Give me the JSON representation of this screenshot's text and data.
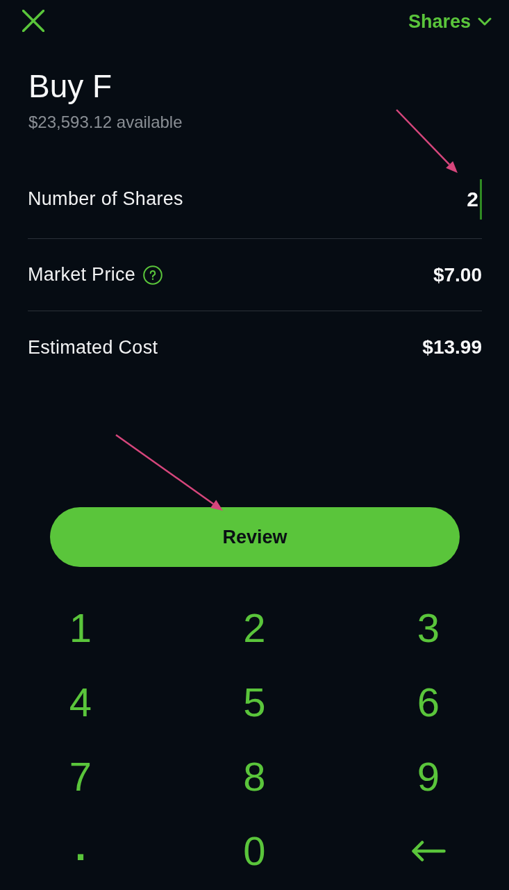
{
  "header": {
    "order_type": {
      "label": "Shares",
      "expanded": false
    }
  },
  "title": "Buy F",
  "buying_power": "$23,593.12 available",
  "rows": [
    {
      "kind": "input",
      "label": "Number of Shares",
      "value": "2",
      "focused": true,
      "help": false
    },
    {
      "kind": "static",
      "label": "Market Price",
      "value": "$7.00",
      "help": true
    },
    {
      "kind": "static",
      "label": "Estimated Cost",
      "value": "$13.99",
      "help": false
    }
  ],
  "review_button": {
    "label": "Review"
  },
  "keypad": [
    {
      "kind": "digit",
      "label": "1"
    },
    {
      "kind": "digit",
      "label": "2"
    },
    {
      "kind": "digit",
      "label": "3"
    },
    {
      "kind": "digit",
      "label": "4"
    },
    {
      "kind": "digit",
      "label": "5"
    },
    {
      "kind": "digit",
      "label": "6"
    },
    {
      "kind": "digit",
      "label": "7"
    },
    {
      "kind": "digit",
      "label": "8"
    },
    {
      "kind": "digit",
      "label": "9"
    },
    {
      "kind": "symbol",
      "label": "."
    },
    {
      "kind": "digit",
      "label": "0"
    },
    {
      "kind": "backspace"
    }
  ],
  "annotations": [
    {
      "kind": "arrow"
    },
    {
      "kind": "arrow"
    }
  ]
}
